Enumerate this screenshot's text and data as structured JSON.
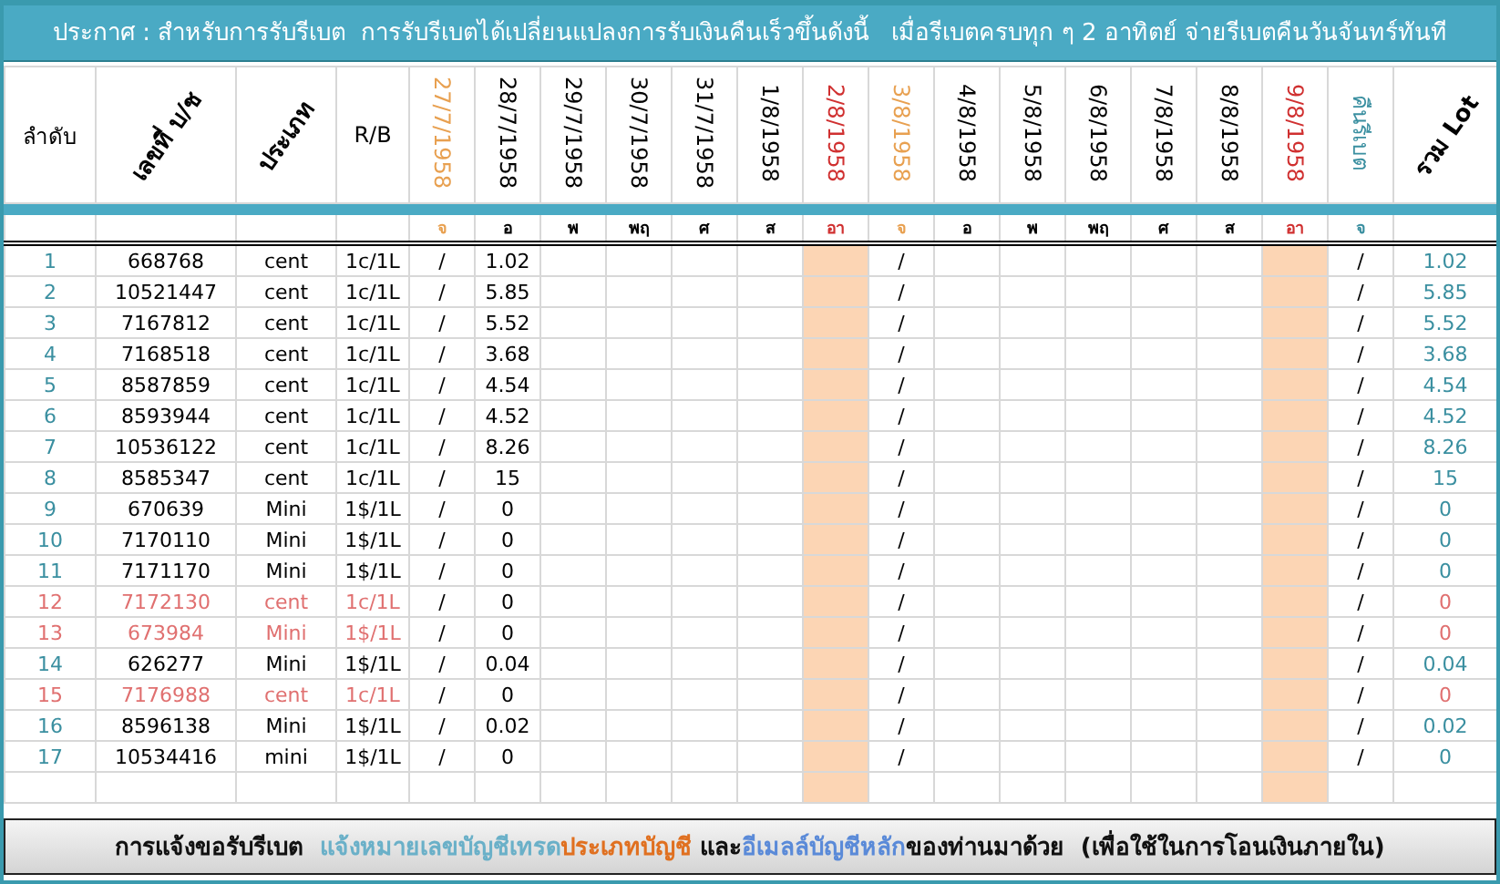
{
  "title": "ประกาศ : สำหรับการรับรีเบต  การรับรีเบตได้เปลี่ยนแปลงการรับเงินคืนเร็วขึ้นดังนี้   เมื่อรีเบตครบทุก ๆ 2 อาทิตย์ จ่ายรีเบตคืนวันจันทร์ทันที",
  "table": {
    "columns": [
      {
        "label": "ลำดับ",
        "kind": "plain"
      },
      {
        "label": "เลขที่ บ/ช",
        "kind": "slanted"
      },
      {
        "label": "ประเภท",
        "kind": "slanted"
      },
      {
        "label": "R/B",
        "kind": "plain"
      },
      {
        "label": "27/7/1958",
        "kind": "date",
        "color": "#e8a050",
        "day": "จ",
        "shaded": false
      },
      {
        "label": "28/7/1958",
        "kind": "date",
        "color": "#000000",
        "day": "อ",
        "shaded": false
      },
      {
        "label": "29/7/1958",
        "kind": "date",
        "color": "#000000",
        "day": "พ",
        "shaded": false
      },
      {
        "label": "30/7/1958",
        "kind": "date",
        "color": "#000000",
        "day": "พฤ",
        "shaded": false
      },
      {
        "label": "31/7/1958",
        "kind": "date",
        "color": "#000000",
        "day": "ศ",
        "shaded": false
      },
      {
        "label": "1/8/1958",
        "kind": "date",
        "color": "#000000",
        "day": "ส",
        "shaded": false
      },
      {
        "label": "2/8/1958",
        "kind": "date",
        "color": "#d03030",
        "day": "อา",
        "shaded": true
      },
      {
        "label": "3/8/1958",
        "kind": "date",
        "color": "#e8a050",
        "day": "จ",
        "shaded": false
      },
      {
        "label": "4/8/1958",
        "kind": "date",
        "color": "#000000",
        "day": "อ",
        "shaded": false
      },
      {
        "label": "5/8/1958",
        "kind": "date",
        "color": "#000000",
        "day": "พ",
        "shaded": false
      },
      {
        "label": "6/8/1958",
        "kind": "date",
        "color": "#000000",
        "day": "พฤ",
        "shaded": false
      },
      {
        "label": "7/8/1958",
        "kind": "date",
        "color": "#000000",
        "day": "ศ",
        "shaded": false
      },
      {
        "label": "8/8/1958",
        "kind": "date",
        "color": "#000000",
        "day": "ส",
        "shaded": false
      },
      {
        "label": "9/8/1958",
        "kind": "date",
        "color": "#d03030",
        "day": "อา",
        "shaded": true
      },
      {
        "label": "คืนรีเบต",
        "kind": "date",
        "color": "#3a8fa0",
        "day": "จ",
        "shaded": false
      },
      {
        "label": "รวม Lot",
        "kind": "slanted"
      }
    ],
    "rows": [
      {
        "no": "1",
        "account": "668768",
        "type": "cent",
        "rb": "1c/1L",
        "day_1": "/",
        "day_2": "1.02",
        "day_8": "/",
        "rebate": "/",
        "total": "1.02",
        "flagged": false
      },
      {
        "no": "2",
        "account": "10521447",
        "type": "cent",
        "rb": "1c/1L",
        "day_1": "/",
        "day_2": "5.85",
        "day_8": "/",
        "rebate": "/",
        "total": "5.85",
        "flagged": false
      },
      {
        "no": "3",
        "account": "7167812",
        "type": "cent",
        "rb": "1c/1L",
        "day_1": "/",
        "day_2": "5.52",
        "day_8": "/",
        "rebate": "/",
        "total": "5.52",
        "flagged": false
      },
      {
        "no": "4",
        "account": "7168518",
        "type": "cent",
        "rb": "1c/1L",
        "day_1": "/",
        "day_2": "3.68",
        "day_8": "/",
        "rebate": "/",
        "total": "3.68",
        "flagged": false
      },
      {
        "no": "5",
        "account": "8587859",
        "type": "cent",
        "rb": "1c/1L",
        "day_1": "/",
        "day_2": "4.54",
        "day_8": "/",
        "rebate": "/",
        "total": "4.54",
        "flagged": false
      },
      {
        "no": "6",
        "account": "8593944",
        "type": "cent",
        "rb": "1c/1L",
        "day_1": "/",
        "day_2": "4.52",
        "day_8": "/",
        "rebate": "/",
        "total": "4.52",
        "flagged": false
      },
      {
        "no": "7",
        "account": "10536122",
        "type": "cent",
        "rb": "1c/1L",
        "day_1": "/",
        "day_2": "8.26",
        "day_8": "/",
        "rebate": "/",
        "total": "8.26",
        "flagged": false
      },
      {
        "no": "8",
        "account": "8585347",
        "type": "cent",
        "rb": "1c/1L",
        "day_1": "/",
        "day_2": "15",
        "day_8": "/",
        "rebate": "/",
        "total": "15",
        "flagged": false
      },
      {
        "no": "9",
        "account": "670639",
        "type": "Mini",
        "rb": "1$/1L",
        "day_1": "/",
        "day_2": "0",
        "day_8": "/",
        "rebate": "/",
        "total": "0",
        "flagged": false
      },
      {
        "no": "10",
        "account": "7170110",
        "type": "Mini",
        "rb": "1$/1L",
        "day_1": "/",
        "day_2": "0",
        "day_8": "/",
        "rebate": "/",
        "total": "0",
        "flagged": false
      },
      {
        "no": "11",
        "account": "7171170",
        "type": "Mini",
        "rb": "1$/1L",
        "day_1": "/",
        "day_2": "0",
        "day_8": "/",
        "rebate": "/",
        "total": "0",
        "flagged": false
      },
      {
        "no": "12",
        "account": "7172130",
        "type": "cent",
        "rb": "1c/1L",
        "day_1": "/",
        "day_2": "0",
        "day_8": "/",
        "rebate": "/",
        "total": "0",
        "flagged": true
      },
      {
        "no": "13",
        "account": "673984",
        "type": "Mini",
        "rb": "1$/1L",
        "day_1": "/",
        "day_2": "0",
        "day_8": "/",
        "rebate": "/",
        "total": "0",
        "flagged": true
      },
      {
        "no": "14",
        "account": "626277",
        "type": "Mini",
        "rb": "1$/1L",
        "day_1": "/",
        "day_2": "0.04",
        "day_8": "/",
        "rebate": "/",
        "total": "0.04",
        "flagged": false
      },
      {
        "no": "15",
        "account": "7176988",
        "type": "cent",
        "rb": "1c/1L",
        "day_1": "/",
        "day_2": "0",
        "day_8": "/",
        "rebate": "/",
        "total": "0",
        "flagged": true
      },
      {
        "no": "16",
        "account": "8596138",
        "type": "Mini",
        "rb": "1$/1L",
        "day_1": "/",
        "day_2": "0.02",
        "day_8": "/",
        "rebate": "/",
        "total": "0.02",
        "flagged": false
      },
      {
        "no": "17",
        "account": "10534416",
        "type": "mini",
        "rb": "1$/1L",
        "day_1": "/",
        "day_2": "0",
        "day_8": "/",
        "rebate": "/",
        "total": "0",
        "flagged": false
      }
    ]
  },
  "footer": [
    {
      "text": "การแจ้งขอรับรีเบต  ",
      "color": "#111111"
    },
    {
      "text": "แจ้งหมายเลขบัญชีเทรด",
      "color": "#6ab0c8"
    },
    {
      "text": "ประเภทบัญชี",
      "color": "#e07020"
    },
    {
      "text": " และ",
      "color": "#111111"
    },
    {
      "text": "อีเมลล์บัญชีหลัก",
      "color": "#5a8ad8"
    },
    {
      "text": "ของท่านมาด้วย  (เพื่อใช้ในการโอนเงินภายใน)",
      "color": "#111111"
    }
  ]
}
